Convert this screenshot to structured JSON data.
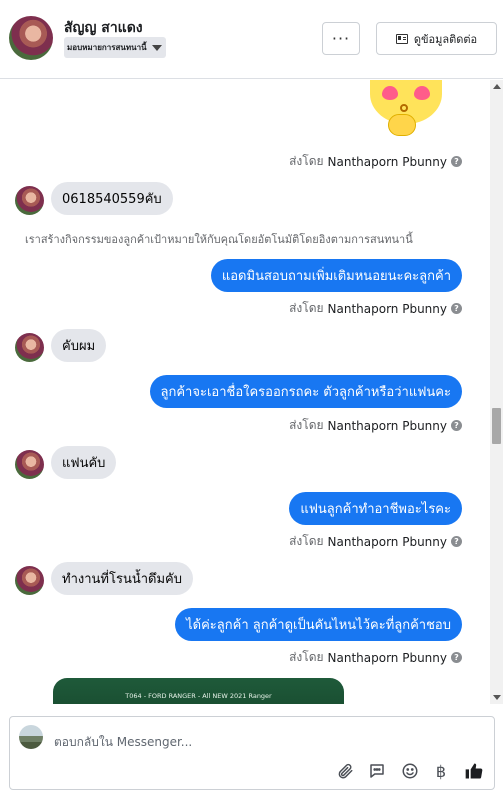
{
  "header": {
    "contact_name": "สัญญ สาแดง",
    "assign_label": "มอบหมายการสนทนานี้",
    "more_label": "···",
    "view_contact_label": "ดูข้อมูลติดต่อ"
  },
  "messages": {
    "sent_by_prefix": "ส่งโดย",
    "agent_name": "Nanthaporn Pbunny",
    "info_glyph": "?",
    "m1_in": "0618540559คับ",
    "system_note": "เราสร้างกิจกรรมของลูกค้าเป้าหมายให้กับคุณโดยอัตโนมัติโดยอิงตามการสนทนานี้",
    "m2_out": "แอดมินสอบถามเพิ่มเติมหนอยนะคะลูกค้า",
    "m3_in": "คับผม",
    "m4_out": "ลูกค้าจะเอาชื่อใครออกรถคะ ตัวลูกค้าหรือว่าแฟนคะ",
    "m5_in": "แฟนคับ",
    "m6_out": "แฟนลูกค้าทำอาชีพอะไรคะ",
    "m7_in": "ทำงานที่โรนน้ำดึมคับ",
    "m8_out": "ได้ค่ะลูกค้า ลูกค้าดูเป็นคันไหนไว้คะที่ลูกค้าชอบ",
    "preview_caption": "T064 - FORD RANGER - All NEW 2021 Ranger"
  },
  "composer": {
    "placeholder": "ตอบกลับใน Messenger...",
    "baht_glyph": "฿"
  }
}
